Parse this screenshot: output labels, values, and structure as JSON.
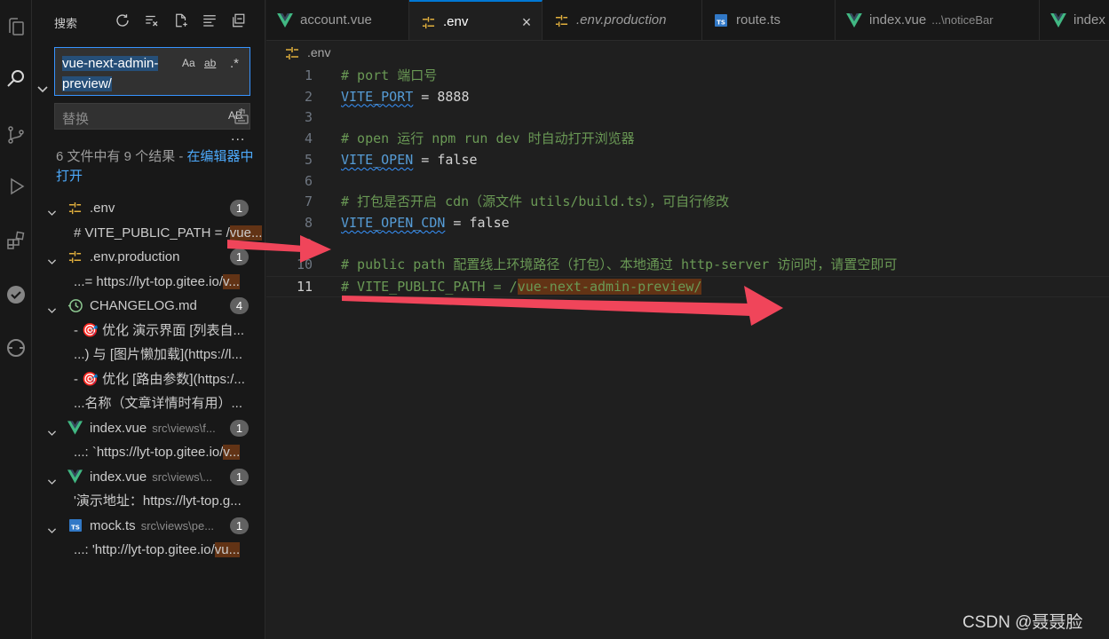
{
  "sidebar": {
    "title": "搜索",
    "search": {
      "value": "vue-next-admin-preview/",
      "opt_case": "Aa",
      "opt_word": "ab",
      "opt_regex": ".*"
    },
    "replace": {
      "placeholder": "替换",
      "preserve_case": "AB"
    },
    "more": "...",
    "summary_text": "6 文件中有 9 个结果 - ",
    "summary_link": "在编辑器中打开",
    "results": [
      {
        "file": ".env",
        "path": "",
        "icon": "settings-file-icon",
        "count": "1"
      },
      {
        "pre": "# VITE_PUBLIC_PATH = /",
        "hl": "vue...",
        "post": ""
      },
      {
        "file": ".env.production",
        "path": "",
        "icon": "settings-file-icon",
        "count": "1"
      },
      {
        "pre": "...= https://lyt-top.gitee.io/",
        "hl": "v...",
        "post": ""
      },
      {
        "file": "CHANGELOG.md",
        "path": "",
        "icon": "history-icon",
        "count": "4"
      },
      {
        "pre": "- 🎯 优化 演示界面 [列表自...",
        "hl": "",
        "post": ""
      },
      {
        "pre": "...) 与 [图片懒加载](https://l...",
        "hl": "",
        "post": ""
      },
      {
        "pre": "- 🎯 优化 [路由参数](https:/...",
        "hl": "",
        "post": ""
      },
      {
        "pre": "...名称（文章详情时有用）...",
        "hl": "",
        "post": ""
      },
      {
        "file": "index.vue",
        "path": "src\\views\\f...",
        "icon": "vue-icon",
        "count": "1"
      },
      {
        "pre": "...: `https://lyt-top.gitee.io/",
        "hl": "v...",
        "post": ""
      },
      {
        "file": "index.vue",
        "path": "src\\views\\...",
        "icon": "vue-icon",
        "count": "1"
      },
      {
        "pre": "'演示地址：https://lyt-top.g...",
        "hl": "",
        "post": ""
      },
      {
        "file": "mock.ts",
        "path": "src\\views\\pe...",
        "icon": "ts-icon",
        "count": "1"
      },
      {
        "pre": "...: 'http://lyt-top.gitee.io/",
        "hl": "vu...",
        "post": ""
      }
    ]
  },
  "tabs": [
    {
      "label": "account.vue",
      "icon": "vue-icon",
      "desc": ""
    },
    {
      "label": ".env",
      "icon": "settings-file-icon",
      "desc": "",
      "active": true,
      "close": "×"
    },
    {
      "label": ".env.production",
      "icon": "settings-file-icon",
      "desc": "",
      "italic": true
    },
    {
      "label": "route.ts",
      "icon": "ts-icon",
      "desc": ""
    },
    {
      "label": "index.vue",
      "icon": "vue-icon",
      "desc": "...\\noticeBar"
    },
    {
      "label": "index",
      "icon": "vue-icon",
      "desc": ""
    }
  ],
  "breadcrumb": ".env",
  "editor": {
    "lines": [
      {
        "n": "1",
        "comment": "# port 端口号"
      },
      {
        "n": "2",
        "key": "VITE_PORT",
        "eq": " = ",
        "val": "8888"
      },
      {
        "n": "3"
      },
      {
        "n": "4",
        "comment": "# open 运行 npm run dev 时自动打开浏览器"
      },
      {
        "n": "5",
        "key": "VITE_OPEN",
        "eq": " = ",
        "val": "false"
      },
      {
        "n": "6"
      },
      {
        "n": "7",
        "comment": "# 打包是否开启 cdn（源文件 utils/build.ts），可自行修改"
      },
      {
        "n": "8",
        "key": "VITE_OPEN_CDN",
        "eq": " = ",
        "val": "false"
      },
      {
        "n": "9"
      },
      {
        "n": "10",
        "comment": "# public path 配置线上环境路径（打包）、本地通过 http-server 访问时，请置空即可"
      },
      {
        "n": "11",
        "comment_pre": "# VITE_PUBLIC_PATH = /",
        "comment_hl": "vue-next-admin-preview/",
        "current": true
      }
    ]
  },
  "watermark": "CSDN @聂聂脸",
  "colors": {
    "accent": "#0078d4",
    "vue": "#41b883",
    "ts": "#3178c6",
    "annotation_arrow": "#f0455a"
  }
}
